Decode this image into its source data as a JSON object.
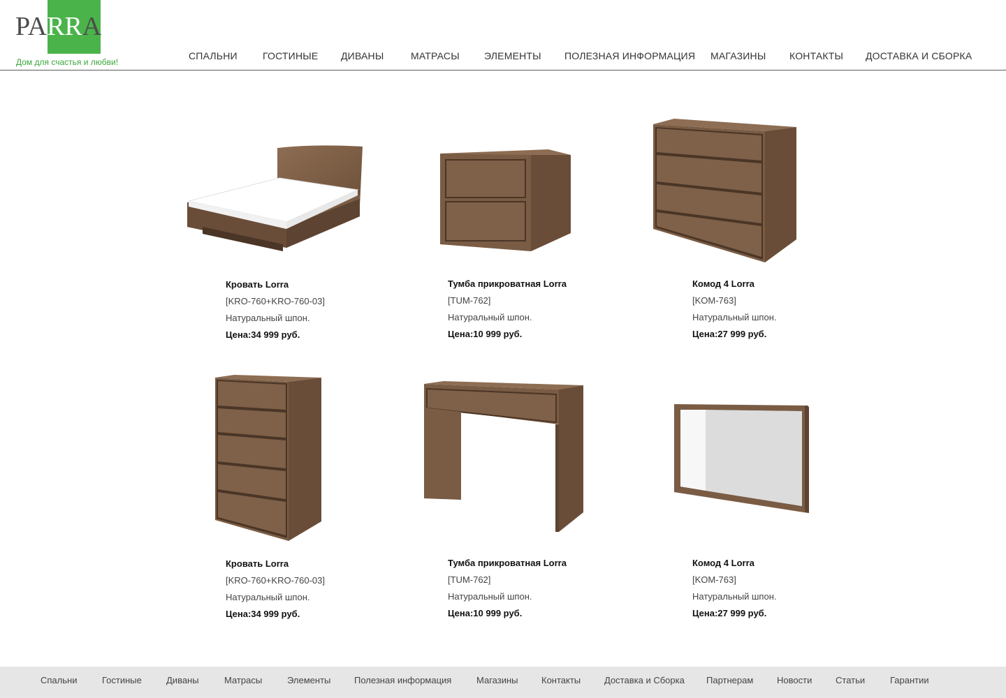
{
  "logo": {
    "text_part1": "PA",
    "text_part2": "RR",
    "text_part3": "A",
    "tagline": "Дом для счастья и любви!",
    "brand_green": "#4ab44a"
  },
  "nav": {
    "items": [
      {
        "label": "СПАЛЬНИ"
      },
      {
        "label": "ГОСТИНЫЕ"
      },
      {
        "label": "ДИВАНЫ"
      },
      {
        "label": "МАТРАСЫ"
      },
      {
        "label": "ЭЛЕМЕНТЫ"
      },
      {
        "label": "ПОЛЕЗНАЯ ИНФОРМАЦИЯ"
      },
      {
        "label": "МАГАЗИНЫ"
      },
      {
        "label": "КОНТАКТЫ"
      },
      {
        "label": "ДОСТАВКА И СБОРКА"
      }
    ]
  },
  "products": [
    {
      "title": "Кровать Lorra",
      "sku": "[KRO-760+KRO-760-03]",
      "desc": "Натуральный шпон.",
      "price": "Цена:34 999 руб.",
      "icon": "bed-image"
    },
    {
      "title": "Тумба прикроватная Lorra",
      "sku": "[TUM-762]",
      "desc": "Натуральный шпон.",
      "price": "Цена:10 999 руб.",
      "icon": "nightstand-image"
    },
    {
      "title": "Комод 4 Lorra",
      "sku": "[KOM-763]",
      "desc": "Натуральный шпон.",
      "price": "Цена:27 999 руб.",
      "icon": "dresser-image"
    },
    {
      "title": "Кровать Lorra",
      "sku": "[KRO-760+KRO-760-03]",
      "desc": "Натуральный шпон.",
      "price": "Цена:34 999 руб.",
      "icon": "tall-chest-image"
    },
    {
      "title": "Тумба прикроватная Lorra",
      "sku": "[TUM-762]",
      "desc": "Натуральный шпон.",
      "price": "Цена:10 999 руб.",
      "icon": "console-table-image"
    },
    {
      "title": "Комод 4 Lorra",
      "sku": "[KOM-763]",
      "desc": "Натуральный шпон.",
      "price": "Цена:27 999 руб.",
      "icon": "mirror-image"
    }
  ],
  "footer": {
    "items": [
      {
        "label": "Спальни"
      },
      {
        "label": "Гостиные"
      },
      {
        "label": "Диваны"
      },
      {
        "label": "Матрасы"
      },
      {
        "label": "Элементы"
      },
      {
        "label": "Полезная информация"
      },
      {
        "label": "Магазины"
      },
      {
        "label": "Контакты"
      },
      {
        "label": "Доставка и Сборка"
      },
      {
        "label": "Партнерам"
      },
      {
        "label": "Новости"
      },
      {
        "label": "Статьи"
      },
      {
        "label": "Гарантии"
      }
    ]
  },
  "colors": {
    "wood": "#7a5c44",
    "wood_dark": "#4a3526",
    "wood_light": "#8d6d53",
    "footer_bg": "#e6e6e6"
  }
}
